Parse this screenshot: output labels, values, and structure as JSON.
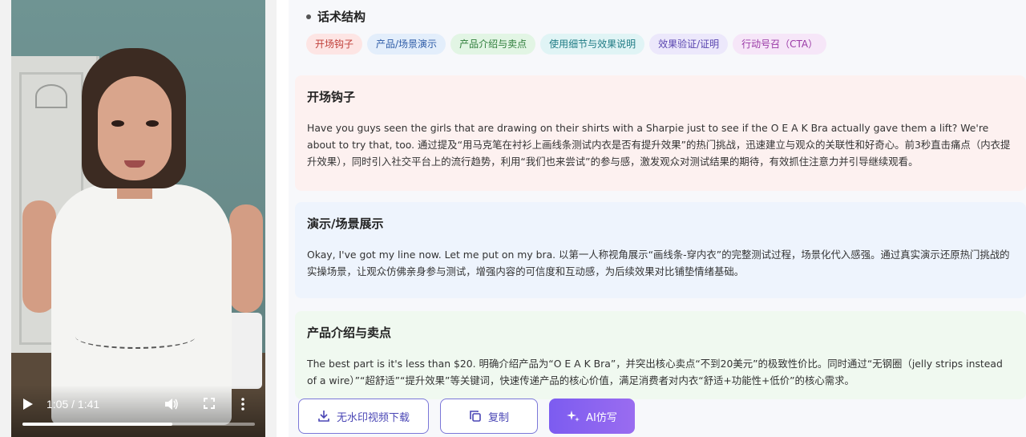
{
  "video": {
    "time": "1:05 / 1:41",
    "progress_fraction": 0.645,
    "icons": [
      "play-icon",
      "volume-icon",
      "fullscreen-icon",
      "more-vert-icon"
    ]
  },
  "structure": {
    "title": "话术结构",
    "tags": [
      {
        "label": "开场钩子",
        "bg": "#fde5e4",
        "fg": "#c0403a"
      },
      {
        "label": "产品/场景演示",
        "bg": "#e3eefb",
        "fg": "#2f5da8"
      },
      {
        "label": "产品介绍与卖点",
        "bg": "#e2f5e4",
        "fg": "#2e7d3a"
      },
      {
        "label": "使用细节与效果说明",
        "bg": "#e0f4f5",
        "fg": "#1f7b84"
      },
      {
        "label": "效果验证/证明",
        "bg": "#ece8fb",
        "fg": "#5a46b0"
      },
      {
        "label": "行动号召（CTA）",
        "bg": "#f6e6f8",
        "fg": "#9a3aa6"
      }
    ]
  },
  "sections": [
    {
      "title": "开场钩子",
      "text": "Have you guys seen the girls that are drawing on their shirts with a Sharpie just to see if the O E A K Bra actually gave them a lift? We're about to try that, too. 通过提及“用马克笔在衬衫上画线条测试内衣是否有提升效果”的热门挑战，迅速建立与观众的关联性和好奇心。前3秒直击痛点（内衣提升效果），同时引入社交平台上的流行趋势，利用“我们也来尝试”的参与感，激发观众对测试结果的期待，有效抓住注意力并引导继续观看。"
    },
    {
      "title": "演示/场景展示",
      "text": "Okay, I've got my line now. Let me put on my bra. 以第一人称视角展示“画线条-穿内衣”的完整测试过程，场景化代入感强。通过真实演示还原热门挑战的实操场景，让观众仿佛亲身参与测试，增强内容的可信度和互动感，为后续效果对比铺垫情绪基础。"
    },
    {
      "title": "产品介绍与卖点",
      "text": "The best part is it's less than $20. 明确介绍产品为“O E A K Bra”，并突出核心卖点“不到20美元”的极致性价比。同时通过“无钢圈（jelly strips instead of a wire）”“超舒适”“提升效果”等关键词，快速传递产品的核心价值，满足消费者对内衣“舒适+功能性+低价”的核心需求。"
    }
  ],
  "actions": {
    "download": "无水印视频下载",
    "copy": "复制",
    "ai": "AI仿写"
  }
}
